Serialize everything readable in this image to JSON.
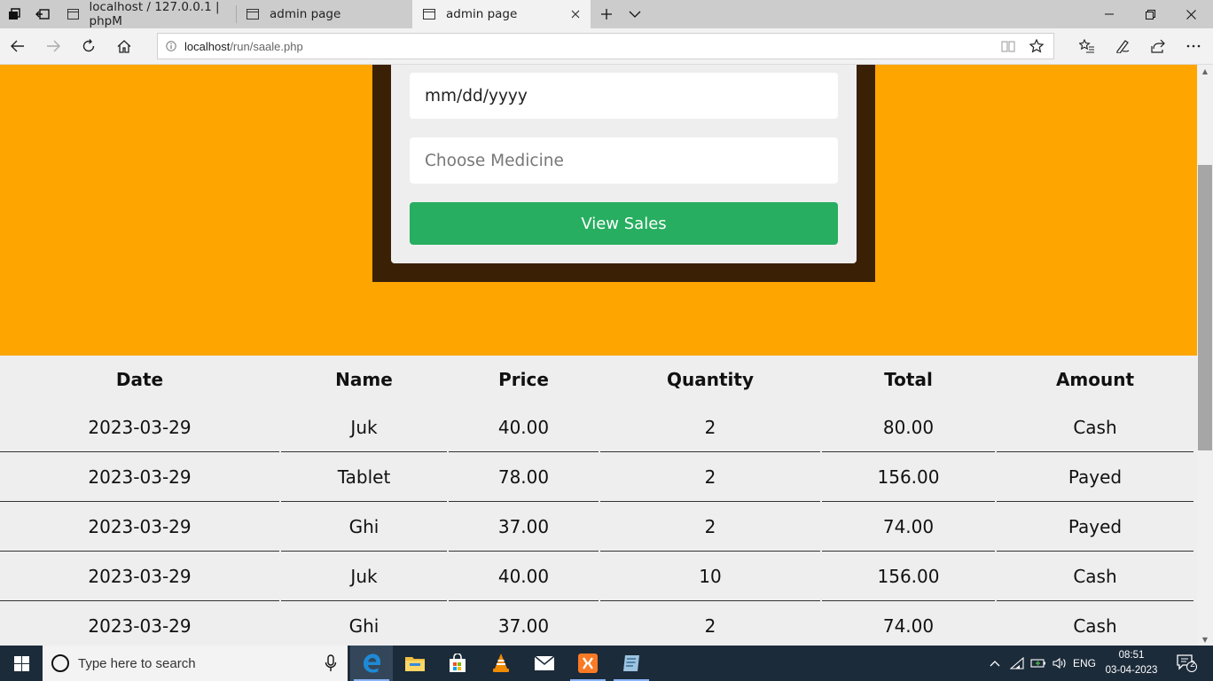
{
  "browser": {
    "tabs": [
      {
        "title": "localhost / 127.0.0.1 | phpM",
        "active": false
      },
      {
        "title": "admin page",
        "active": false
      },
      {
        "title": "admin page",
        "active": true
      }
    ],
    "url_host": "localhost",
    "url_path": "/run/saale.php"
  },
  "form": {
    "date_placeholder": "mm/dd/yyyy",
    "medicine_placeholder": "Choose Medicine",
    "submit_label": "View Sales"
  },
  "table": {
    "headers": [
      "Date",
      "Name",
      "Price",
      "Quantity",
      "Total",
      "Amount"
    ],
    "rows": [
      [
        "2023-03-29",
        "Juk",
        "40.00",
        "2",
        "80.00",
        "Cash"
      ],
      [
        "2023-03-29",
        "Tablet",
        "78.00",
        "2",
        "156.00",
        "Payed"
      ],
      [
        "2023-03-29",
        "Ghi",
        "37.00",
        "2",
        "74.00",
        "Payed"
      ],
      [
        "2023-03-29",
        "Juk",
        "40.00",
        "10",
        "156.00",
        "Cash"
      ],
      [
        "2023-03-29",
        "Ghi",
        "37.00",
        "2",
        "74.00",
        "Cash"
      ]
    ]
  },
  "colors": {
    "hero_bg": "#ffa500",
    "panel_border": "#3a2106",
    "button_bg": "#27ae60"
  },
  "taskbar": {
    "search_placeholder": "Type here to search",
    "language": "ENG",
    "time": "08:51",
    "date": "03-04-2023",
    "notification_count": "2"
  }
}
